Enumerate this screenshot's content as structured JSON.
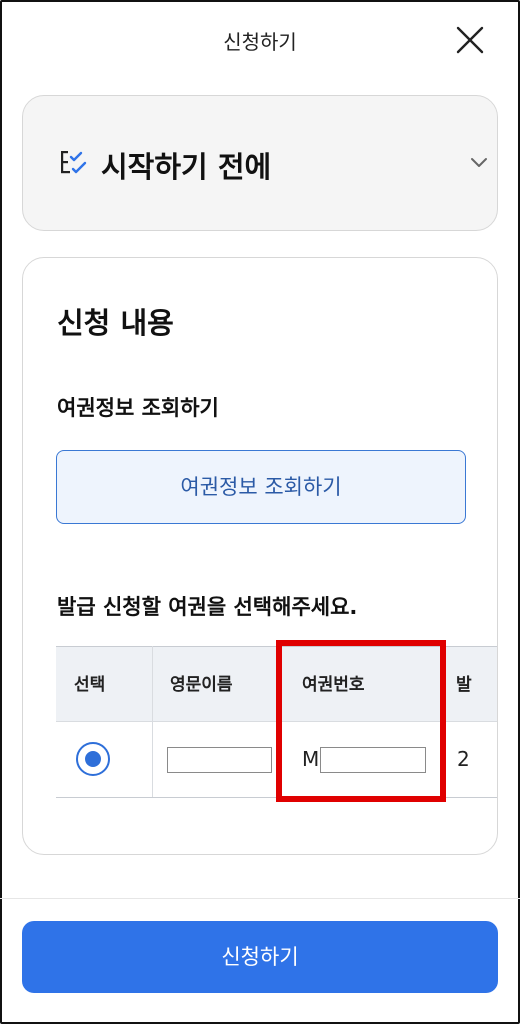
{
  "header": {
    "title": "신청하기",
    "close_icon": "close-icon"
  },
  "before_start": {
    "title": "시작하기 전에",
    "icon": "checklist-icon",
    "expand_icon": "chevron-down-icon"
  },
  "application": {
    "title": "신청 내용",
    "passport_lookup_label": "여권정보 조회하기",
    "passport_lookup_button": "여권정보 조회하기",
    "select_passport_label": "발급 신청할 여권을 선택해주세요.",
    "table": {
      "headers": [
        "선택",
        "영문이름",
        "여권번호",
        "발"
      ],
      "rows": [
        {
          "selected": true,
          "english_name": "",
          "passport_prefix": "M",
          "passport_number": "",
          "next_col_partial": "2"
        }
      ]
    }
  },
  "colors": {
    "accent": "#2f73e8",
    "highlight": "#e00000"
  },
  "submit_button": "신청하기"
}
